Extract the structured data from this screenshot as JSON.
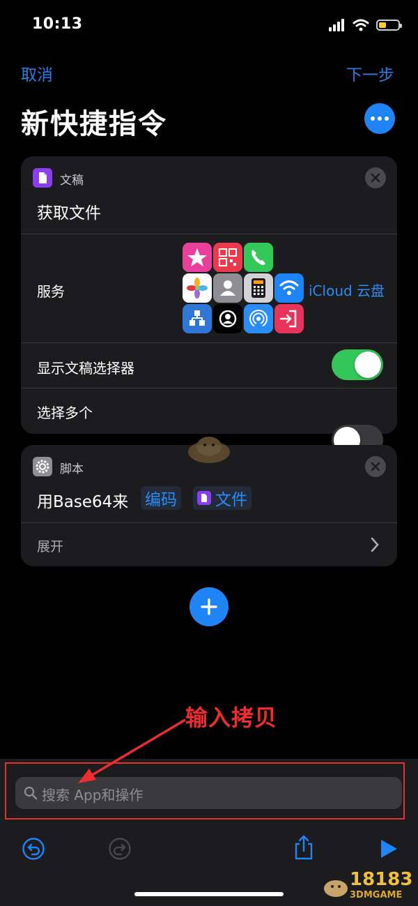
{
  "status": {
    "time": "10:13"
  },
  "nav": {
    "cancel": "取消",
    "next": "下一步",
    "title": "新快捷指令"
  },
  "card1": {
    "category": "文稿",
    "action": "获取文件",
    "service_label": "服务",
    "service_value": "iCloud 云盘",
    "show_picker_label": "显示文稿选择器",
    "show_picker_on": true,
    "select_multiple_label": "选择多个",
    "select_multiple_on": false
  },
  "card2": {
    "category": "脚本",
    "action_prefix": "用Base64来",
    "token_encode": "编码",
    "token_file": "文件",
    "expand_label": "展开"
  },
  "annotation": "输入拷贝",
  "search": {
    "placeholder": "搜索 App和操作"
  },
  "watermark": {
    "brand": "18183",
    "sub": "3DMGAME"
  },
  "colors": {
    "accent": "#1f84f5",
    "toggle_on": "#33c759",
    "annotation": "#ee2e2e"
  }
}
